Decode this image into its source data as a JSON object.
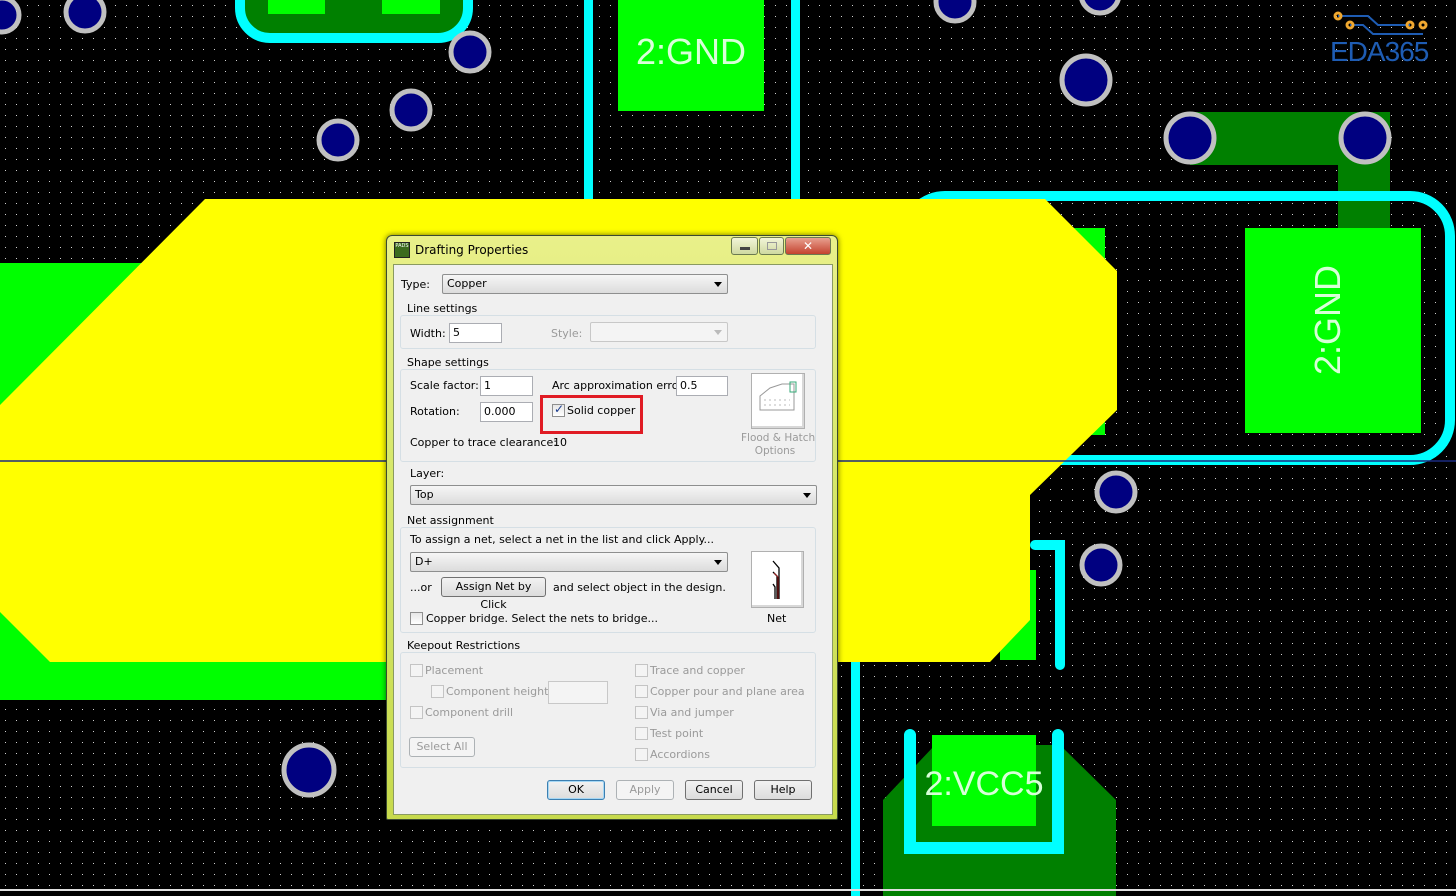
{
  "canvas": {
    "pad_labels": [
      "2:GND",
      "2:GND",
      "2:VCC5"
    ],
    "logo_text": "EDA365",
    "colors": {
      "background": "#000000",
      "copper_pour": "#ffff00",
      "pad": "#00ff00",
      "trace": "#00ffff",
      "plane": "#008000",
      "via": "#000080"
    }
  },
  "dialog": {
    "title": "Drafting Properties",
    "app_icon": "PADS",
    "type_label": "Type:",
    "type_value": "Copper",
    "line_settings": {
      "label": "Line settings",
      "width_label": "Width:",
      "width_value": "5",
      "style_label": "Style:",
      "style_value": ""
    },
    "shape_settings": {
      "label": "Shape settings",
      "scale_label": "Scale factor:",
      "scale_value": "1",
      "arc_label": "Arc approximation error:",
      "arc_value": "0.5",
      "rotation_label": "Rotation:",
      "rotation_value": "0.000",
      "solid_copper_label": "Solid copper",
      "solid_copper_checked": true,
      "clearance_label": "Copper to trace clearance:",
      "clearance_value": "10",
      "flood_label_1": "Flood & Hatch",
      "flood_label_2": "Options"
    },
    "layer": {
      "label": "Layer:",
      "value": "Top"
    },
    "net_assignment": {
      "label": "Net assignment",
      "instruction": "To assign a net, select a net in the list and click Apply...",
      "net_value": "D+",
      "or_label": "...or",
      "assign_button": "Assign Net by Click",
      "assign_suffix": "and select object in the design.",
      "bridge_label": "Copper bridge. Select the nets to bridge...",
      "net_button_label": "Net"
    },
    "keepout": {
      "label": "Keepout Restrictions",
      "placement": "Placement",
      "component_height": "Component height",
      "component_drill": "Component drill",
      "select_all": "Select All",
      "trace_copper": "Trace and copper",
      "copper_pour": "Copper pour and plane area",
      "via_jumper": "Via and jumper",
      "test_point": "Test point",
      "accordions": "Accordions"
    },
    "buttons": {
      "ok": "OK",
      "apply": "Apply",
      "cancel": "Cancel",
      "help": "Help"
    }
  }
}
